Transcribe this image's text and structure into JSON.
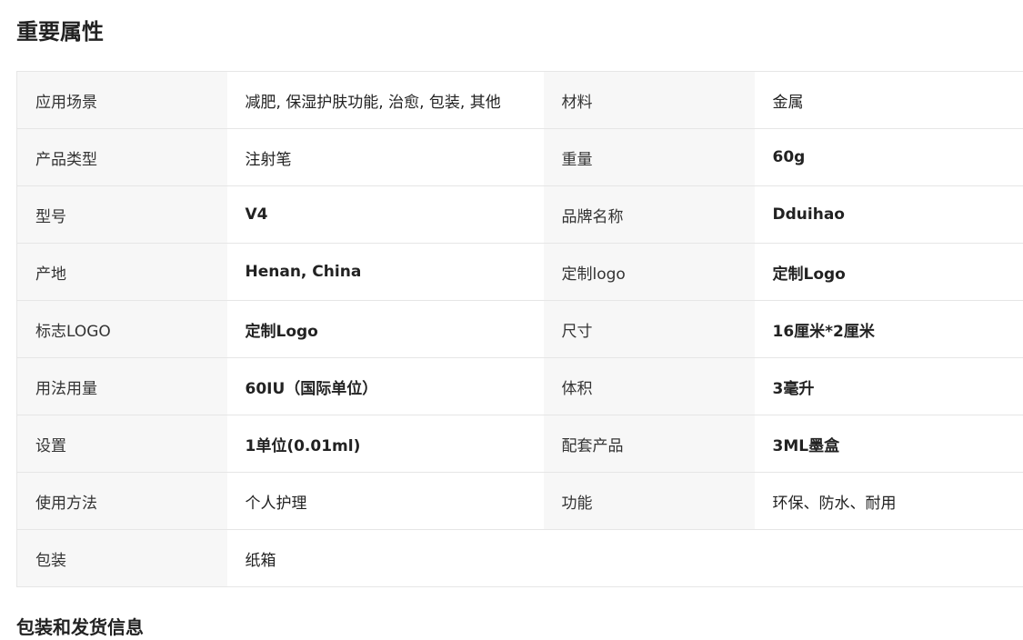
{
  "section_title": "重要属性",
  "rows": [
    {
      "k1": "应用场景",
      "v1": "减肥, 保湿护肤功能, 治愈, 包装, 其他",
      "k2": "材料",
      "v2": "金属"
    },
    {
      "k1": "产品类型",
      "v1": "注射笔",
      "k2": "重量",
      "v2": "60g"
    },
    {
      "k1": "型号",
      "v1": "V4",
      "k2": "品牌名称",
      "v2": "Dduihao"
    },
    {
      "k1": "产地",
      "v1": "Henan, China",
      "k2": "定制logo",
      "v2": "定制Logo"
    },
    {
      "k1": "标志LOGO",
      "v1": "定制Logo",
      "k2": "尺寸",
      "v2": "16厘米*2厘米"
    },
    {
      "k1": "用法用量",
      "v1": "60IU（国际单位）",
      "k2": "体积",
      "v2": "3毫升"
    },
    {
      "k1": "设置",
      "v1": "1单位(0.01ml)",
      "k2": "配套产品",
      "v2": "3ML墨盒"
    },
    {
      "k1": "使用方法",
      "v1": "个人护理",
      "k2": "功能",
      "v2": "环保、防水、耐用"
    },
    {
      "k1": "包装",
      "v1": "纸箱"
    }
  ],
  "next_section_title": "包装和发货信息"
}
